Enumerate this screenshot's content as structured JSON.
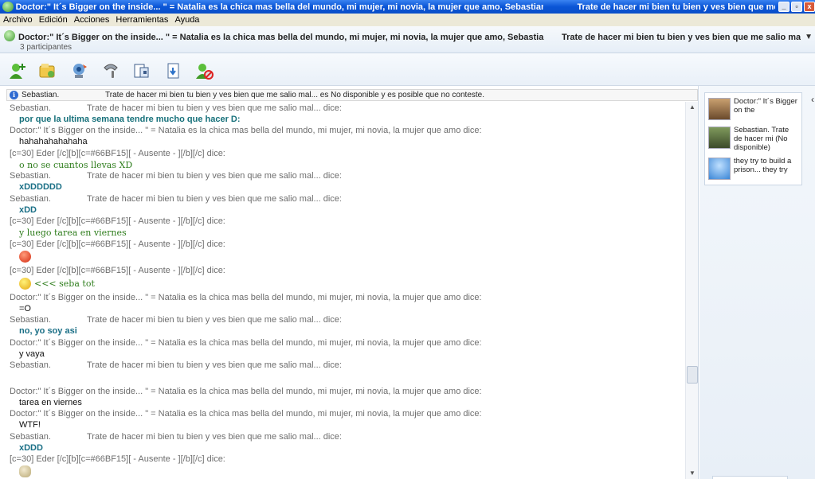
{
  "window": {
    "title": "Doctor:\"  It´s Bigger on the inside... \" = Natalia es la chica mas bella del mundo, mi mujer, mi novia, la mujer que amo, Sebastian.",
    "status": "Trate de hacer mi bien tu bien y ves bien que me salio m...",
    "buttons": [
      "_",
      "▫",
      "x"
    ]
  },
  "menu": [
    "Archivo",
    "Edición",
    "Acciones",
    "Herramientas",
    "Ayuda"
  ],
  "header": {
    "name": "Doctor:\"  It´s Bigger on the inside... \" = Natalia es la chica mas bella del mundo, mi mujer, mi novia, la mujer que amo, Sebastian.",
    "status": "Trate de hacer mi bien tu bien y ves bien que me salio mal..., t...",
    "participants": "3 participantes"
  },
  "toolbar": {
    "icons": [
      "invite-contact-icon",
      "send-files-icon",
      "webcam-icon",
      "call-icon",
      "activities-icon",
      "games-icon",
      "block-icon"
    ]
  },
  "infobar": {
    "sender": "Sebastian.",
    "text": "Trate de hacer mi bien tu bien y ves bien que me salio mal... es No disponible y es posible que no conteste."
  },
  "conversation": [
    {
      "sender": "Sebastian.",
      "name": "Trate de hacer mi bien tu bien y ves bien que me salio mal... dice:",
      "message": "por que la ultima semana tendre mucho que hacer D:",
      "style": "bold-teal"
    },
    {
      "sender": "Doctor:\"  It´s Bigger on the inside... \" = Natalia es la chica mas bella del mundo, mi mujer, mi novia, la mujer que amo dice:",
      "name": "",
      "message": "hahahahahahaha",
      "style": "black"
    },
    {
      "sender": "[c=30]  Eder [/c][b][c=#66BF15][ - Ausente -  ][/b][/c] dice:",
      "name": "",
      "message": "o no se cuantos llevas XD",
      "style": "green-serif"
    },
    {
      "sender": "Sebastian.",
      "name": "Trate de hacer mi bien tu bien y ves bien que me salio mal... dice:",
      "message": "xDDDDDD",
      "style": "blue-bold"
    },
    {
      "sender": "Sebastian.",
      "name": "Trate de hacer mi bien tu bien y ves bien que me salio mal... dice:",
      "message": "xDD",
      "style": "blue-bold"
    },
    {
      "sender": "[c=30]  Eder [/c][b][c=#66BF15][ - Ausente -  ][/b][/c] dice:",
      "name": "",
      "message": "y luego tarea en viernes",
      "style": "green-serif"
    },
    {
      "sender": "[c=30]  Eder [/c][b][c=#66BF15][ - Ausente -  ][/b][/c] dice:",
      "name": "",
      "message": "",
      "style": "emo-angry"
    },
    {
      "sender": "[c=30]  Eder [/c][b][c=#66BF15][ - Ausente -  ][/b][/c] dice:",
      "name": "",
      "message": "<<< seba tot",
      "style": "green-serif-emo"
    },
    {
      "sender": "Doctor:\"  It´s Bigger on the inside... \" = Natalia es la chica mas bella del mundo, mi mujer, mi novia, la mujer que amo dice:",
      "name": "",
      "message": "=O",
      "style": "black"
    },
    {
      "sender": "Sebastian.",
      "name": "Trate de hacer mi bien tu bien y ves bien que me salio mal... dice:",
      "message": "no, yo soy asi",
      "style": "blue-bold"
    },
    {
      "sender": "Doctor:\"  It´s Bigger on the inside... \" = Natalia es la chica mas bella del mundo, mi mujer, mi novia, la mujer que amo dice:",
      "name": "",
      "message": "y vaya",
      "style": "black"
    },
    {
      "sender": "Sebastian.",
      "name": "Trate de hacer mi bien tu bien y ves bien que me salio mal... dice:",
      "message": "",
      "style": "none"
    },
    {
      "sender": "Doctor:\"  It´s Bigger on the inside... \" = Natalia es la chica mas bella del mundo, mi mujer, mi novia, la mujer que amo dice:",
      "name": "",
      "message": "tarea en viernes",
      "style": "black"
    },
    {
      "sender": "Doctor:\"  It´s Bigger on the inside... \" = Natalia es la chica mas bella del mundo, mi mujer, mi novia, la mujer que amo dice:",
      "name": "",
      "message": "WTF!",
      "style": "black"
    },
    {
      "sender": "Sebastian.",
      "name": "Trate de hacer mi bien tu bien y ves bien que me salio mal... dice:",
      "message": "xDDD",
      "style": "blue-bold"
    },
    {
      "sender": "[c=30]  Eder [/c][b][c=#66BF15][ - Ausente -  ][/b][/c] dice:",
      "name": "",
      "message": "",
      "style": "emo-scroll"
    }
  ],
  "participants": [
    {
      "name": "Doctor:\"  It´s Bigger on the",
      "avatar_color": "#a0785a"
    },
    {
      "name": "Sebastian. Trate de hacer mi (No disponible)",
      "avatar_color": "#556b3e"
    },
    {
      "name": "they try to build a prison... they try",
      "avatar_color": "#3b86d6"
    }
  ]
}
